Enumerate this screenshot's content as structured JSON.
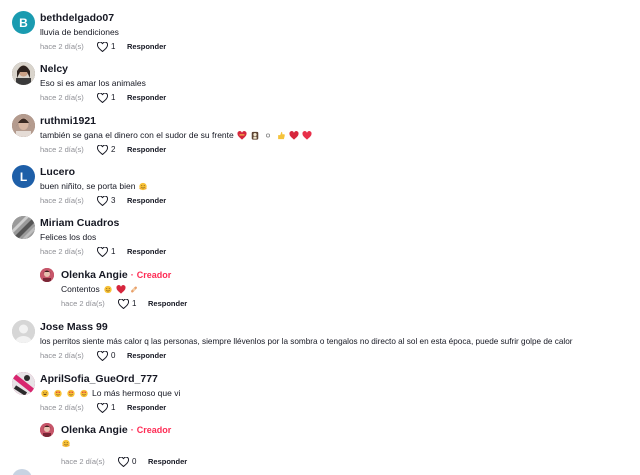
{
  "comments": [
    {
      "username": "bethdelgado07",
      "avatar": {
        "type": "letter",
        "letter": "B",
        "color": "#1a9bb0"
      },
      "text": "lluvia de bendiciones",
      "time": "hace 2 día(s)",
      "likes": "1",
      "reply_label": "Responder"
    },
    {
      "username": "Nelcy",
      "avatar": {
        "type": "photo",
        "color": "#6f6a64"
      },
      "text": "Eso si es amar los animales",
      "time": "hace 2 día(s)",
      "likes": "1",
      "reply_label": "Responder"
    },
    {
      "username": "ruthmi1921",
      "avatar": {
        "type": "photo",
        "color": "#8a6f63"
      },
      "text": "también se gana el dinero con el sudor de su frente",
      "emojis": [
        "heart-with-ribbon",
        "praying-icon",
        "sparkle",
        "thumbs-up",
        "heart",
        "heart"
      ],
      "time": "hace 2 día(s)",
      "likes": "2",
      "reply_label": "Responder"
    },
    {
      "username": "Lucero",
      "avatar": {
        "type": "letter",
        "letter": "L",
        "color": "#1e5fa8"
      },
      "text": "buen niñito, se porta bien",
      "emojis": [
        "hugging-face"
      ],
      "time": "hace 2 día(s)",
      "likes": "3",
      "reply_label": "Responder"
    },
    {
      "username": "Miriam Cuadros",
      "avatar": {
        "type": "photo",
        "color": "#7d7d7d"
      },
      "text": "Felices los dos",
      "time": "hace 2 día(s)",
      "likes": "1",
      "reply_label": "Responder"
    },
    {
      "username": "Olenka Angie",
      "creator_label": "Creador",
      "avatar": {
        "type": "photo",
        "color": "#b0485a"
      },
      "text": "Contentos",
      "emojis": [
        "smiling-face",
        "heart",
        "bandage"
      ],
      "time": "hace 2 día(s)",
      "likes": "1",
      "reply_label": "Responder"
    },
    {
      "username": "Jose Mass 99",
      "avatar": {
        "type": "default",
        "color": "#d0d0d0"
      },
      "text": "los perritos siente más calor q las personas, siempre llévenlos por la sombra o tengalos no directo al sol en esta época, puede sufrir golpe de calor",
      "time": "hace 2 día(s)",
      "likes": "0",
      "reply_label": "Responder"
    },
    {
      "username": "AprilSofia_GueOrd_777",
      "avatar": {
        "type": "photo",
        "color": "#c0336a"
      },
      "text": "Lo más hermoso que vi",
      "emojis_before": [
        "grinning-face",
        "heart-eyes",
        "heart-eyes",
        "heart-eyes"
      ],
      "time": "hace 2 día(s)",
      "likes": "1",
      "reply_label": "Responder"
    },
    {
      "username": "Olenka Angie",
      "creator_label": "Creador",
      "avatar": {
        "type": "photo",
        "color": "#b0485a"
      },
      "text": "",
      "emojis": [
        "hugging-face"
      ],
      "time": "hace 2 día(s)",
      "likes": "0",
      "reply_label": "Responder"
    }
  ],
  "colors": {
    "creator": "#fe2c55",
    "secondary_text": "#8a8b91"
  }
}
